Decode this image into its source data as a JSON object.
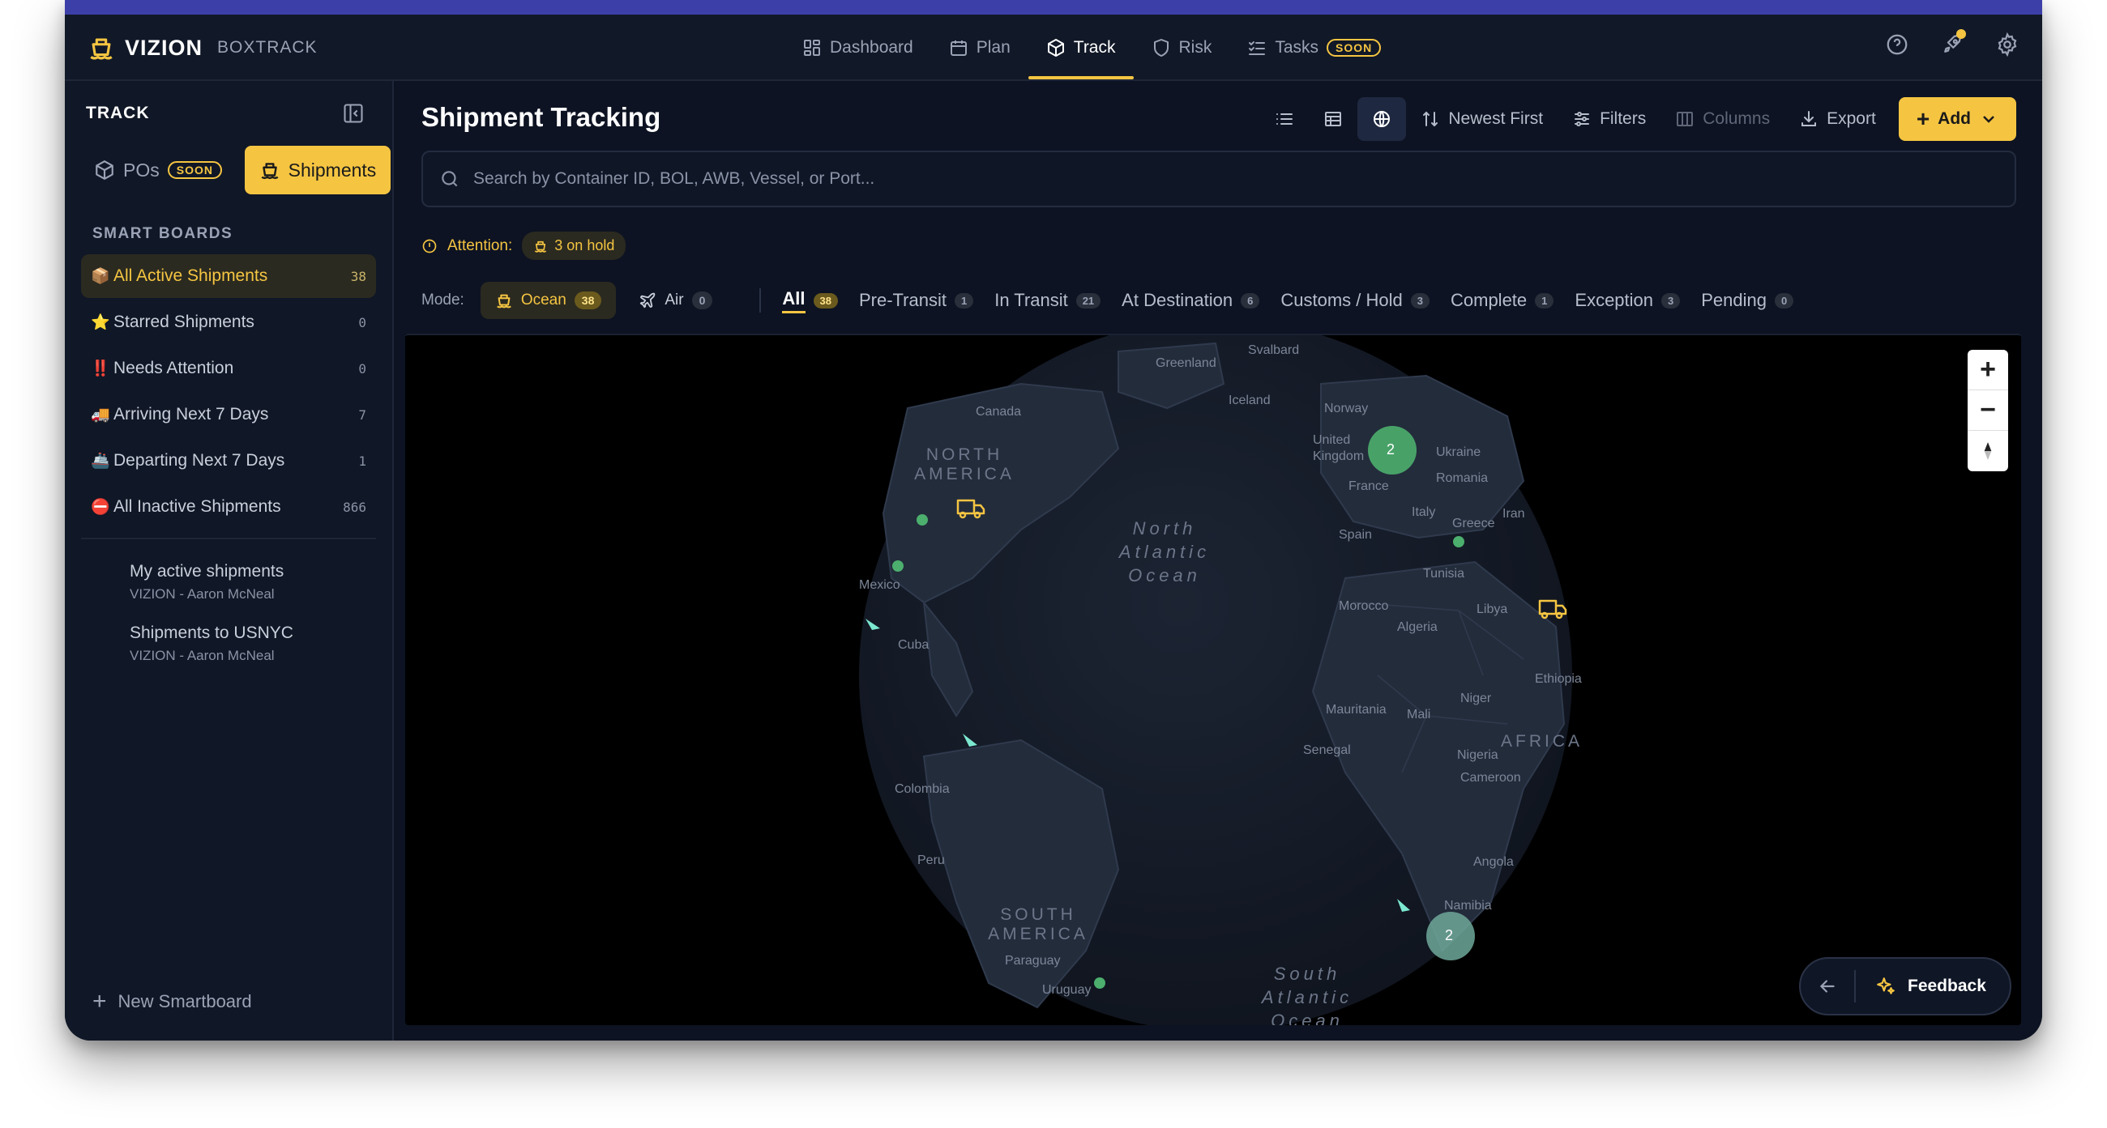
{
  "brand": {
    "name": "VIZION",
    "sub": "BOXTRACK"
  },
  "nav": {
    "items": [
      {
        "label": "Dashboard",
        "icon": "dashboard-icon"
      },
      {
        "label": "Plan",
        "icon": "calendar-icon"
      },
      {
        "label": "Track",
        "icon": "box-icon"
      },
      {
        "label": "Risk",
        "icon": "shield-icon"
      },
      {
        "label": "Tasks",
        "icon": "tasks-icon"
      }
    ],
    "active": "Track",
    "soon_label": "SOON"
  },
  "sidebar": {
    "heading": "TRACK",
    "toggle": {
      "pos_label": "POs",
      "pos_badge": "SOON",
      "shipments_label": "Shipments"
    },
    "section": "SMART BOARDS",
    "boards": [
      {
        "emoji": "📦",
        "label": "All Active Shipments",
        "count": "38"
      },
      {
        "emoji": "⭐",
        "label": "Starred Shipments",
        "count": "0"
      },
      {
        "emoji": "‼️",
        "label": "Needs Attention",
        "count": "0"
      },
      {
        "emoji": "🚚",
        "label": "Arriving Next 7 Days",
        "count": "7"
      },
      {
        "emoji": "🚢",
        "label": "Departing Next 7 Days",
        "count": "1"
      },
      {
        "emoji": "⛔",
        "label": "All Inactive Shipments",
        "count": "866"
      }
    ],
    "saved": [
      {
        "title": "My active shipments",
        "owner": "VIZION - Aaron McNeal"
      },
      {
        "title": "Shipments to USNYC",
        "owner": "VIZION - Aaron McNeal"
      }
    ],
    "new_smartboard": "New Smartboard"
  },
  "main": {
    "title": "Shipment Tracking",
    "toolbar": {
      "sort": "Newest First",
      "filters": "Filters",
      "columns": "Columns",
      "export": "Export",
      "add": "Add"
    },
    "search_placeholder": "Search by Container ID, BOL, AWB, Vessel, or Port...",
    "attention": {
      "label": "Attention:",
      "hold": "3 on hold"
    },
    "mode": {
      "label": "Mode:",
      "ocean": {
        "label": "Ocean",
        "count": "38"
      },
      "air": {
        "label": "Air",
        "count": "0"
      }
    },
    "status_tabs": [
      {
        "label": "All",
        "count": "38"
      },
      {
        "label": "Pre-Transit",
        "count": "1"
      },
      {
        "label": "In Transit",
        "count": "21"
      },
      {
        "label": "At Destination",
        "count": "6"
      },
      {
        "label": "Customs / Hold",
        "count": "3"
      },
      {
        "label": "Complete",
        "count": "1"
      },
      {
        "label": "Exception",
        "count": "3"
      },
      {
        "label": "Pending",
        "count": "0"
      }
    ]
  },
  "map": {
    "labels": {
      "greenland": "Greenland",
      "svalbard": "Svalbard",
      "canada": "Canada",
      "iceland": "Iceland",
      "norway": "Norway",
      "uk": "United Kingdom",
      "ukraine": "Ukraine",
      "romania": "Romania",
      "france": "France",
      "italy": "Italy",
      "greece": "Greece",
      "iran": "Iran",
      "spain": "Spain",
      "tunisia": "Tunisia",
      "morocco": "Morocco",
      "libya": "Libya",
      "algeria": "Algeria",
      "ethiopia": "Ethiopia",
      "mexico": "Mexico",
      "cuba": "Cuba",
      "mauritania": "Mauritania",
      "mali": "Mali",
      "niger": "Niger",
      "senegal": "Senegal",
      "nigeria": "Nigeria",
      "cameroon": "Cameroon",
      "colombia": "Colombia",
      "peru": "Peru",
      "angola": "Angola",
      "namibia": "Namibia",
      "paraguay": "Paraguay",
      "uruguay": "Uruguay",
      "north_america": "NORTH AMERICA",
      "south_america": "SOUTH AMERICA",
      "africa": "AFRICA",
      "north_atlantic": "North Atlantic Ocean",
      "south_atlantic": "South Atlantic Ocean"
    },
    "clusters": [
      {
        "count": "2"
      },
      {
        "count": "2"
      }
    ],
    "feedback": "Feedback"
  },
  "colors": {
    "accent": "#f5c542",
    "bg": "#0d1322",
    "cluster": "#4caf6e",
    "vessel": "#7de8d0"
  }
}
